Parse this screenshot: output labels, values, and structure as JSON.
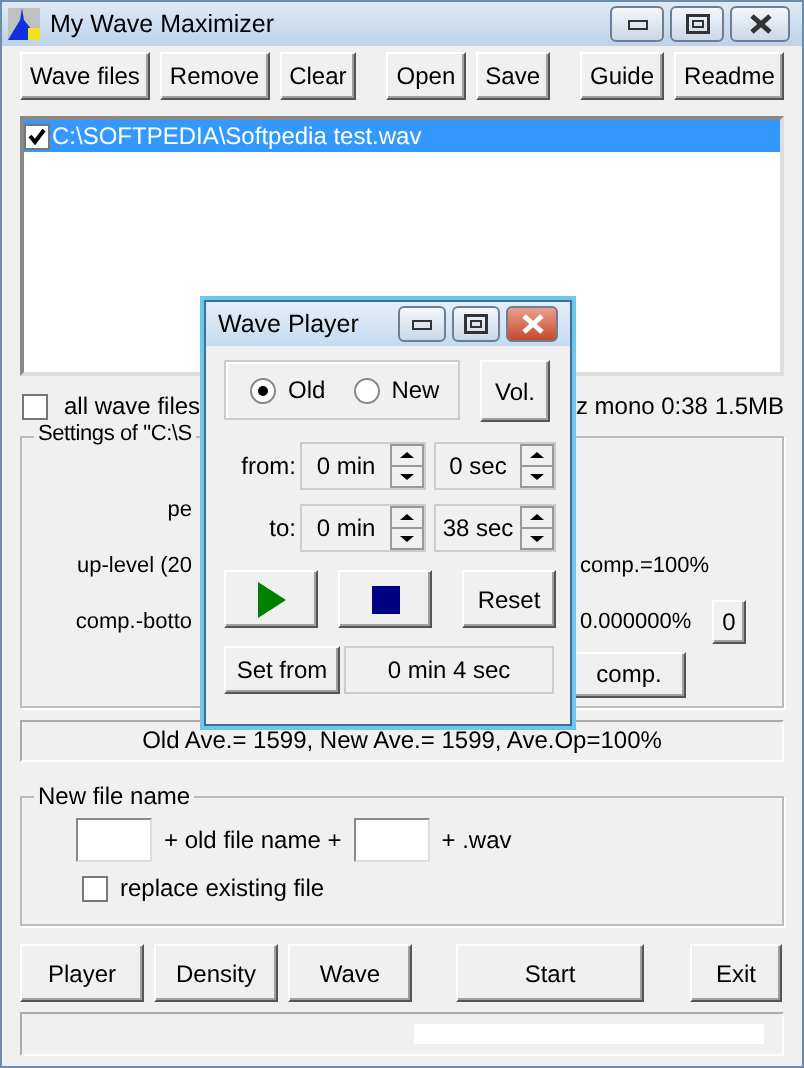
{
  "window": {
    "title": "My Wave Maximizer"
  },
  "toolbar": [
    {
      "label": "Wave files"
    },
    {
      "label": "Remove"
    },
    {
      "label": "Clear"
    },
    {
      "label": "Open"
    },
    {
      "label": "Save"
    },
    {
      "label": "Guide"
    },
    {
      "label": "Readme"
    }
  ],
  "file_list": [
    {
      "label": "C:\\SOFTPEDIA\\Softpedia test.wav",
      "checked": true,
      "selected": true
    }
  ],
  "all_wave_files": {
    "label": "all wave files",
    "checked": false
  },
  "file_info": "z mono 0:38 1.5MB",
  "settings": {
    "legend": "Settings of \"C:\\S",
    "rows": [
      {
        "label": "pe"
      },
      {
        "label": "up-level (20",
        "value": "comp.=100%"
      },
      {
        "label": "comp.-botto",
        "value": "0.000000%",
        "button": "0"
      }
    ],
    "button": "comp."
  },
  "averages": "Old Ave.= 1599, New Ave.= 1599, Ave.Op=100%",
  "new_file": {
    "legend": "New file name",
    "middle": "+ old file name +",
    "ext": "+ .wav",
    "replace": {
      "label": "replace existing file",
      "checked": false
    }
  },
  "bottom_buttons": [
    {
      "label": "Player"
    },
    {
      "label": "Density"
    },
    {
      "label": "Wave"
    },
    {
      "label": "Start"
    },
    {
      "label": "Exit"
    }
  ],
  "player": {
    "title": "Wave Player",
    "radios": [
      {
        "label": "Old",
        "selected": true
      },
      {
        "label": "New",
        "selected": false
      }
    ],
    "vol": "Vol.",
    "ranges": [
      {
        "label": "from:",
        "min": "0 min",
        "sec": "0 sec"
      },
      {
        "label": "to:",
        "min": "0 min",
        "sec": "38 sec"
      }
    ],
    "reset": "Reset",
    "set_from": "Set from",
    "position": "0 min 4 sec"
  }
}
